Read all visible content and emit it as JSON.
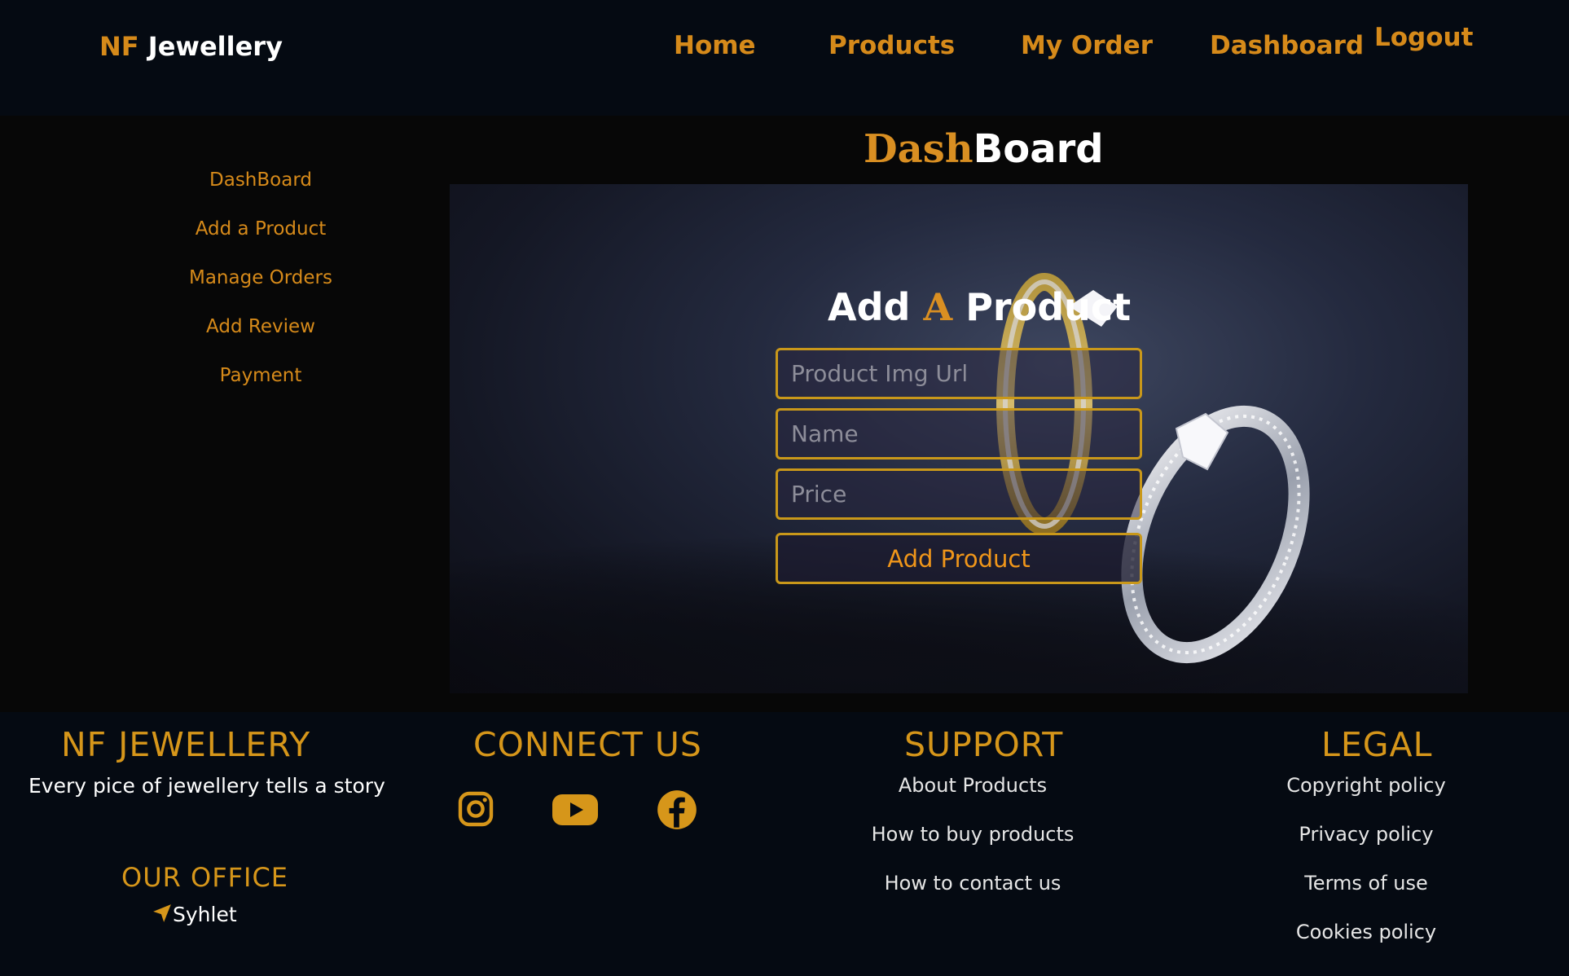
{
  "navbar": {
    "brand_nf": "NF",
    "brand_name": "Jewellery",
    "links": [
      "Home",
      "Products",
      "My Order",
      "Dashboard",
      "Logout"
    ]
  },
  "sidebar": {
    "items": [
      "DashBoard",
      "Add a Product",
      "Manage Orders",
      "Add Review",
      "Payment"
    ]
  },
  "main": {
    "title_part1": "Dash",
    "title_part2": "Board",
    "form": {
      "title_part1": "Add ",
      "title_part2": "A",
      "title_part3": " Product",
      "img_placeholder": "Product Img Url",
      "name_placeholder": "Name",
      "price_placeholder": "Price",
      "submit_label": "Add Product"
    }
  },
  "footer": {
    "brand": {
      "heading": "NF JEWELLERY",
      "tagline": "Every pice of jewellery tells a story",
      "office_heading": "OUR OFFICE",
      "office_location": "Syhlet"
    },
    "connect": {
      "heading": "CONNECT US",
      "icons": [
        "instagram-icon",
        "youtube-icon",
        "facebook-icon"
      ]
    },
    "support": {
      "heading": "SUPPORT",
      "links": [
        "About Products",
        "How to buy products",
        "How to contact us"
      ]
    },
    "legal": {
      "heading": "LEGAL",
      "links": [
        "Copyright policy",
        "Privacy policy",
        "Terms of use",
        "Cookies policy"
      ]
    }
  },
  "colors": {
    "accent": "#d68a1a",
    "background": "#050a12",
    "panel": "#070707",
    "field_border": "#c9981a"
  }
}
